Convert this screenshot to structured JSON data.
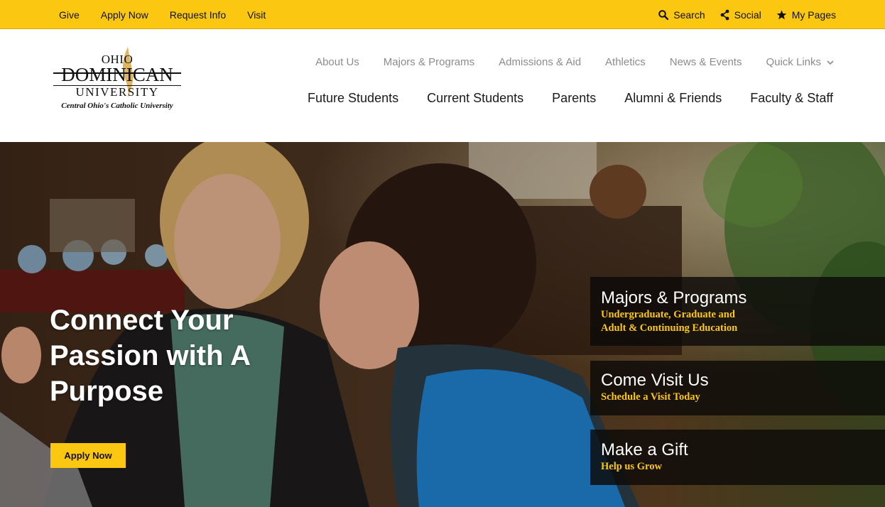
{
  "utility": {
    "left_links": [
      "Give",
      "Apply Now",
      "Request Info",
      "Visit"
    ],
    "search": "Search",
    "social": "Social",
    "my_pages": "My Pages",
    "icons": {
      "search": "search-icon",
      "social": "share-icon",
      "my_pages": "star-icon"
    }
  },
  "logo": {
    "line1": "OHIO",
    "line2": "DOMINICAN",
    "line3": "UNIVERSITY",
    "tagline": "Central Ohio's Catholic University"
  },
  "nav_secondary": [
    "About Us",
    "Majors & Programs",
    "Admissions & Aid",
    "Athletics",
    "News & Events",
    "Quick Links"
  ],
  "nav_primary": [
    "Future Students",
    "Current Students",
    "Parents",
    "Alumni & Friends",
    "Faculty & Staff"
  ],
  "hero": {
    "headline": "Connect Your Passion with A Purpose",
    "cta": "Apply Now"
  },
  "cards": [
    {
      "title": "Majors & Programs",
      "sub1": "Undergraduate, Graduate and",
      "sub2": "Adult & Continuing Education"
    },
    {
      "title": "Come Visit Us",
      "sub1": "Schedule a Visit Today"
    },
    {
      "title": "Make a Gift",
      "sub1": "Help us Grow"
    }
  ],
  "colors": {
    "accent": "#fcc710",
    "text": "#111111",
    "nav_muted": "#8c8c8c"
  }
}
